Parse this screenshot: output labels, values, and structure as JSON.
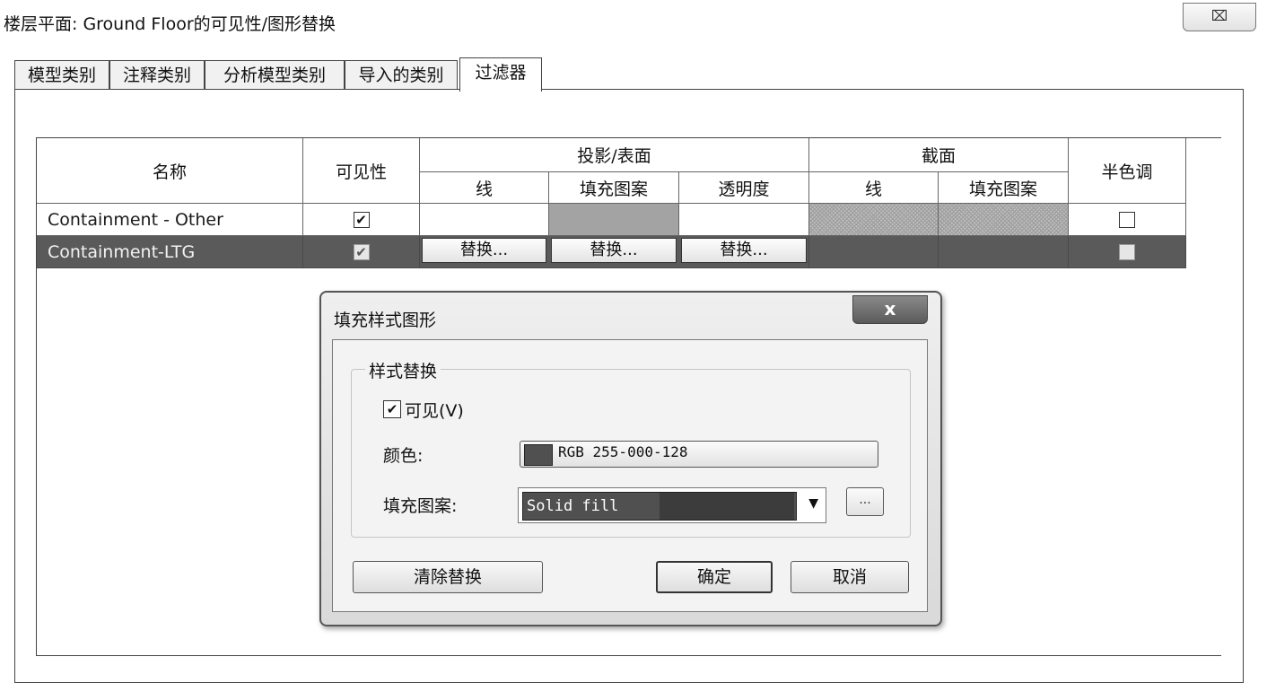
{
  "window": {
    "title": "楼层平面: Ground Floor的可见性/图形替换",
    "close_glyph": "⌧"
  },
  "tabs": [
    {
      "label": "模型类别"
    },
    {
      "label": "注释类别"
    },
    {
      "label": "分析模型类别"
    },
    {
      "label": "导入的类别"
    },
    {
      "label": "过滤器",
      "active": true
    }
  ],
  "table": {
    "headers": {
      "name": "名称",
      "visibility": "可见性",
      "projection_surface": "投影/表面",
      "cut": "截面",
      "halftone": "半色调",
      "line": "线",
      "fill_pattern": "填充图案",
      "transparency": "透明度",
      "cut_line": "线",
      "cut_fill_pattern": "填充图案"
    },
    "rows": [
      {
        "name": "Containment - Other",
        "visible": "✔",
        "halftone": ""
      },
      {
        "name": "Containment-LTG",
        "visible": "✔",
        "halftone": "",
        "selected": true,
        "override_line": "替换...",
        "override_fill": "替换...",
        "override_transparency": "替换..."
      }
    ]
  },
  "dialog": {
    "title": "填充样式图形",
    "close_glyph": "x",
    "group_title": "样式替换",
    "visible_check": "✔",
    "visible_label": "可见(V)",
    "color_label": "颜色:",
    "color_value": "RGB 255-000-128",
    "fill_label": "填充图案:",
    "fill_value": "Solid fill",
    "dropdown_glyph": "▼",
    "browse_label": "...",
    "clear_button": "清除替换",
    "ok_button": "确定",
    "cancel_button": "取消"
  }
}
